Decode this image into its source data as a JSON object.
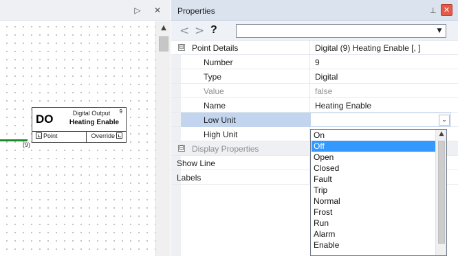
{
  "canvas": {
    "header_buttons": {
      "scroll_right": "▷",
      "close": "✕"
    },
    "scroll_up": "▲",
    "block": {
      "type_short": "DO",
      "type_label": "Digital Output",
      "number": "9",
      "title": "Heating Enable",
      "pin_left": "Point",
      "pin_right": "Override",
      "wire_label": "(9)",
      "wire_color": "#1f8a2a"
    }
  },
  "properties": {
    "title": "Properties",
    "pin_icon": "pushpin-icon",
    "pin_glyph": "⊥",
    "close_glyph": "✕",
    "toolbar": {
      "back": "<",
      "forward": ">",
      "help": "?",
      "object_value": "",
      "select_caret": "▼"
    },
    "rows": [
      {
        "label": "Point Details",
        "value": "Digital (9) Heating Enable [, ]",
        "kind": "category"
      },
      {
        "label": "Number",
        "value": "9"
      },
      {
        "label": "Type",
        "value": "Digital"
      },
      {
        "label": "Value",
        "value": "false",
        "muted": true
      },
      {
        "label": "Name",
        "value": "Heating Enable"
      },
      {
        "label": "Low Unit",
        "value": "",
        "selected": true
      },
      {
        "label": "High Unit",
        "value": ""
      },
      {
        "label": "Display Properties",
        "value": "",
        "kind": "category"
      },
      {
        "label": "Show Line",
        "value": ""
      },
      {
        "label": "Labels",
        "value": ""
      }
    ],
    "collapse_glyph": "⊟",
    "dropdown": {
      "caret": "⌄",
      "selected": "Off",
      "options": [
        "On",
        "Off",
        "Open",
        "Closed",
        "Fault",
        "Trip",
        "Normal",
        "Frost",
        "Run",
        "Alarm",
        "Enable"
      ],
      "highlight_color": "#3399ff"
    }
  }
}
